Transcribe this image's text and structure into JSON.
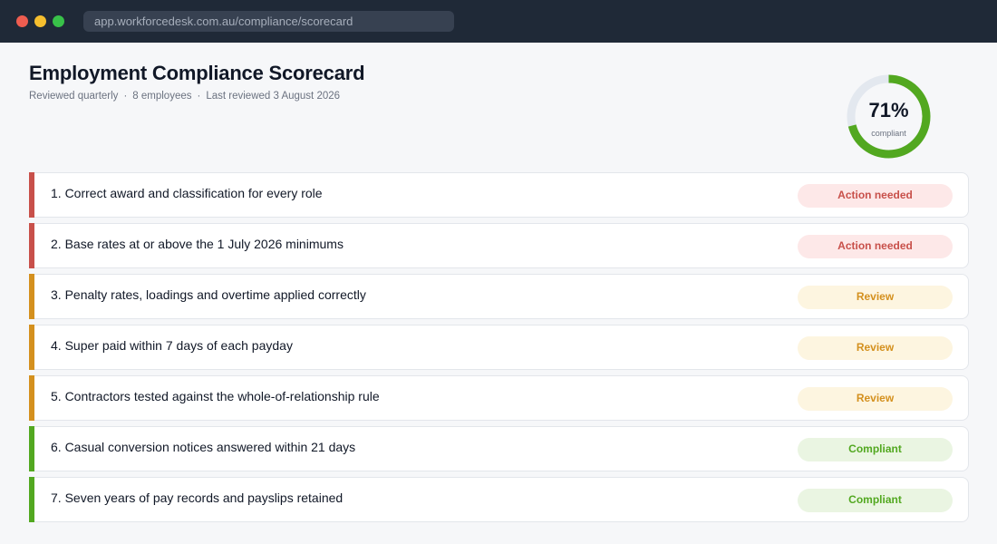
{
  "browser": {
    "url": "app.workforcedesk.com.au/compliance/scorecard"
  },
  "header": {
    "title": "Employment Compliance Scorecard",
    "meta": [
      "Reviewed quarterly",
      "8 employees",
      "Last reviewed 3 August 2026"
    ],
    "separator": "·"
  },
  "score": {
    "value": "71%",
    "percent": 71,
    "label": "compliant",
    "color": "#52a820",
    "track_color": "#e3e8ef"
  },
  "items": [
    {
      "label": "1. Correct award and classification for every role",
      "status": "Action needed",
      "level": "red"
    },
    {
      "label": "2. Base rates at or above the 1 July 2026 minimums",
      "status": "Action needed",
      "level": "red"
    },
    {
      "label": "3. Penalty rates, loadings and overtime applied correctly",
      "status": "Review",
      "level": "amber"
    },
    {
      "label": "4. Super paid within 7 days of each payday",
      "status": "Review",
      "level": "amber"
    },
    {
      "label": "5. Contractors tested against the whole-of-relationship rule",
      "status": "Review",
      "level": "amber"
    },
    {
      "label": "6. Casual conversion notices answered within 21 days",
      "status": "Compliant",
      "level": "green"
    },
    {
      "label": "7. Seven years of pay records and payslips retained",
      "status": "Compliant",
      "level": "green"
    }
  ],
  "colors": {
    "action_needed": "#c8504a",
    "review": "#d4901e",
    "compliant": "#52a820"
  }
}
